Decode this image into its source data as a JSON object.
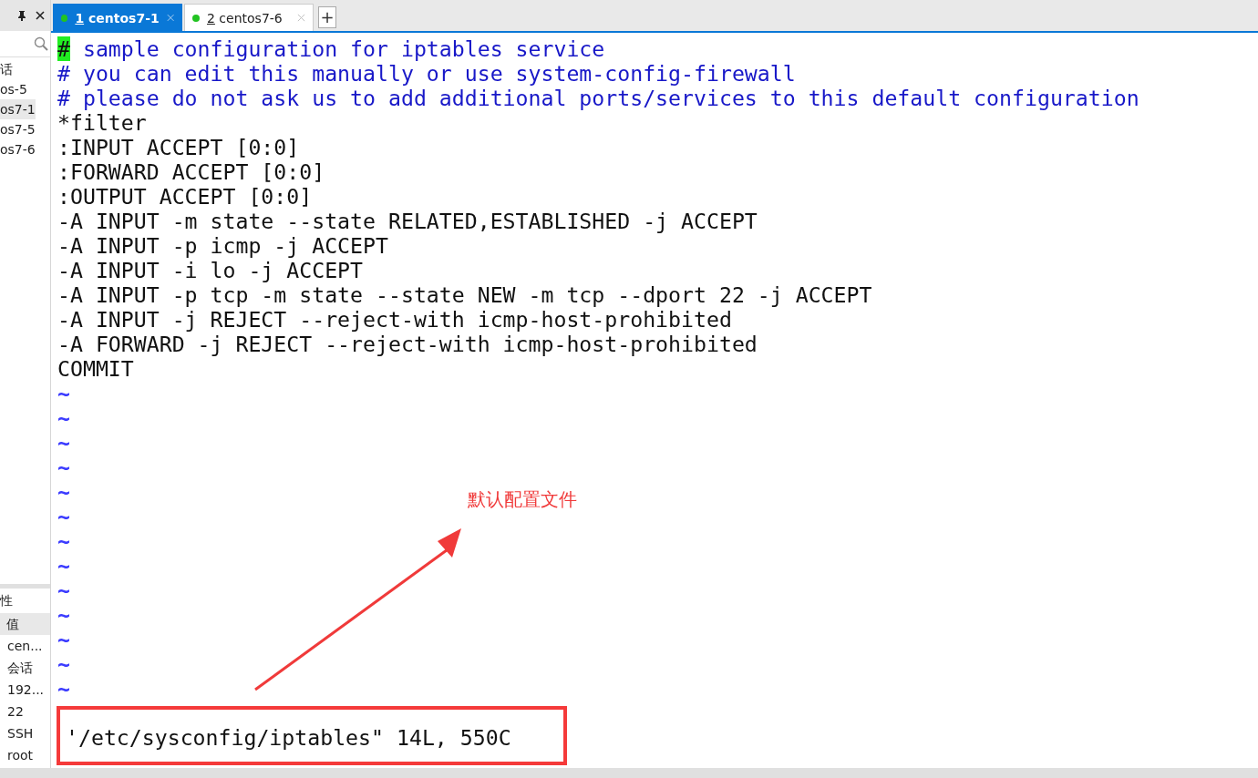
{
  "sidebar": {
    "session_items": [
      {
        "label": "话",
        "selected": false
      },
      {
        "label": "os-5",
        "selected": false
      },
      {
        "label": "os7-1",
        "selected": true
      },
      {
        "label": "os7-5",
        "selected": false
      },
      {
        "label": "os7-6",
        "selected": false
      }
    ],
    "properties": {
      "title": "性",
      "column_header": "值",
      "values": [
        "cen...",
        "会话",
        "192...",
        "22",
        "SSH",
        "root"
      ]
    }
  },
  "tabs": [
    {
      "number": "1",
      "label": "centos7-1",
      "selected": true,
      "connected": true
    },
    {
      "number": "2",
      "label": "centos7-6",
      "selected": false,
      "connected": true
    }
  ],
  "add_tab": "+",
  "editor": {
    "lines": [
      {
        "kind": "comment",
        "cursor_char": "#",
        "text": " sample configuration for iptables service"
      },
      {
        "kind": "comment",
        "text": "# you can edit this manually or use system-config-firewall"
      },
      {
        "kind": "comment",
        "text": "# please do not ask us to add additional ports/services to this default configuration"
      },
      {
        "kind": "code",
        "text": "*filter"
      },
      {
        "kind": "code",
        "text": ":INPUT ACCEPT [0:0]"
      },
      {
        "kind": "code",
        "text": ":FORWARD ACCEPT [0:0]"
      },
      {
        "kind": "code",
        "text": ":OUTPUT ACCEPT [0:0]"
      },
      {
        "kind": "code",
        "text": "-A INPUT -m state --state RELATED,ESTABLISHED -j ACCEPT"
      },
      {
        "kind": "code",
        "text": "-A INPUT -p icmp -j ACCEPT"
      },
      {
        "kind": "code",
        "text": "-A INPUT -i lo -j ACCEPT"
      },
      {
        "kind": "code",
        "text": "-A INPUT -p tcp -m state --state NEW -m tcp --dport 22 -j ACCEPT"
      },
      {
        "kind": "code",
        "text": "-A INPUT -j REJECT --reject-with icmp-host-prohibited"
      },
      {
        "kind": "code",
        "text": "-A FORWARD -j REJECT --reject-with icmp-host-prohibited"
      },
      {
        "kind": "code",
        "text": "COMMIT"
      },
      {
        "kind": "tilde",
        "text": "~"
      },
      {
        "kind": "tilde",
        "text": "~"
      },
      {
        "kind": "tilde",
        "text": "~"
      },
      {
        "kind": "tilde",
        "text": "~"
      },
      {
        "kind": "tilde",
        "text": "~"
      },
      {
        "kind": "tilde",
        "text": "~"
      },
      {
        "kind": "tilde",
        "text": "~"
      },
      {
        "kind": "tilde",
        "text": "~"
      },
      {
        "kind": "tilde",
        "text": "~"
      },
      {
        "kind": "tilde",
        "text": "~"
      },
      {
        "kind": "tilde",
        "text": "~"
      },
      {
        "kind": "tilde",
        "text": "~"
      },
      {
        "kind": "tilde",
        "text": "~"
      }
    ],
    "status_message": "'/etc/sysconfig/iptables\" 14L, 550C"
  },
  "annotation": {
    "label": "默认配置文件"
  }
}
